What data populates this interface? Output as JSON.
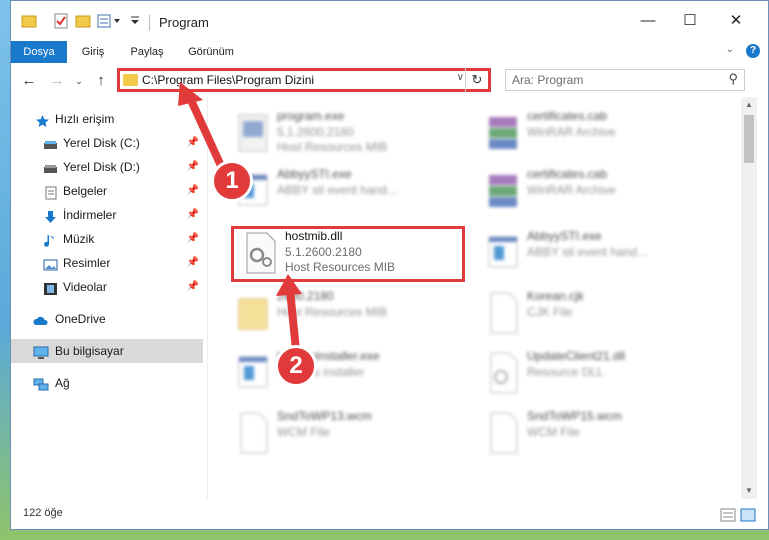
{
  "window": {
    "title": "Program",
    "controls": {
      "minimize": "—",
      "maximize": "☐",
      "close": "✕"
    }
  },
  "ribbon": {
    "tabs": [
      "Dosya",
      "Giriş",
      "Paylaş",
      "Görünüm"
    ],
    "active_tab": "Dosya"
  },
  "address": {
    "path": "C:\\Program Files\\Program Dizini",
    "search_placeholder": "Ara: Program"
  },
  "sidebar": {
    "items": [
      {
        "label": "Hızlı erişim",
        "icon": "star-icon"
      },
      {
        "label": "Yerel Disk (C:)",
        "icon": "drive-icon",
        "pinned": true
      },
      {
        "label": "Yerel Disk (D:)",
        "icon": "drive-icon",
        "pinned": true
      },
      {
        "label": "Belgeler",
        "icon": "documents-icon",
        "pinned": true
      },
      {
        "label": "İndirmeler",
        "icon": "download-icon",
        "pinned": true
      },
      {
        "label": "Müzik",
        "icon": "music-icon",
        "pinned": true
      },
      {
        "label": "Resimler",
        "icon": "pictures-icon",
        "pinned": true
      },
      {
        "label": "Videolar",
        "icon": "video-icon",
        "pinned": true
      },
      {
        "label": "OneDrive",
        "icon": "cloud-icon"
      },
      {
        "label": "Bu bilgisayar",
        "icon": "computer-icon",
        "selected": true
      },
      {
        "label": "Ağ",
        "icon": "network-icon"
      }
    ]
  },
  "files": [
    {
      "name": "program.exe",
      "line1": "5.1.2600.2180",
      "line2": "Host Resources MIB"
    },
    {
      "name": "certificates.cab",
      "line1": "WinRAR Archive",
      "line2": ""
    },
    {
      "name": "AbbyySTI.exe",
      "line1": "ABBY sti event hand...",
      "line2": ""
    },
    {
      "name": "certificates.cab",
      "line1": "WinRAR Archive",
      "line2": ""
    },
    {
      "name": "hostmib.dll",
      "line1": "5.1.2600.2180",
      "line2": "Host Resources MIB"
    },
    {
      "name": "AbbyySTI.exe",
      "line1": "ABBY sti event hand...",
      "line2": ""
    },
    {
      "name": "2600.2180",
      "line1": "Host Resources MIB",
      "line2": ""
    },
    {
      "name": "Korean.cjk",
      "line1": "CJK File",
      "line2": ""
    },
    {
      "name": "UpdateInstaller.exe",
      "line1": "updates installer",
      "line2": ""
    },
    {
      "name": "UpdateClient21.dll",
      "line1": "Resource DLL",
      "line2": ""
    },
    {
      "name": "SndToWP13.wcm",
      "line1": "WCM File",
      "line2": ""
    },
    {
      "name": "SndToWP15.wcm",
      "line1": "WCM File",
      "line2": ""
    }
  ],
  "status": {
    "count": "122 öğe"
  },
  "annotations": {
    "badge1": "1",
    "badge2": "2"
  },
  "colors": {
    "highlight": "#e03a3a",
    "accent": "#1979ca"
  }
}
